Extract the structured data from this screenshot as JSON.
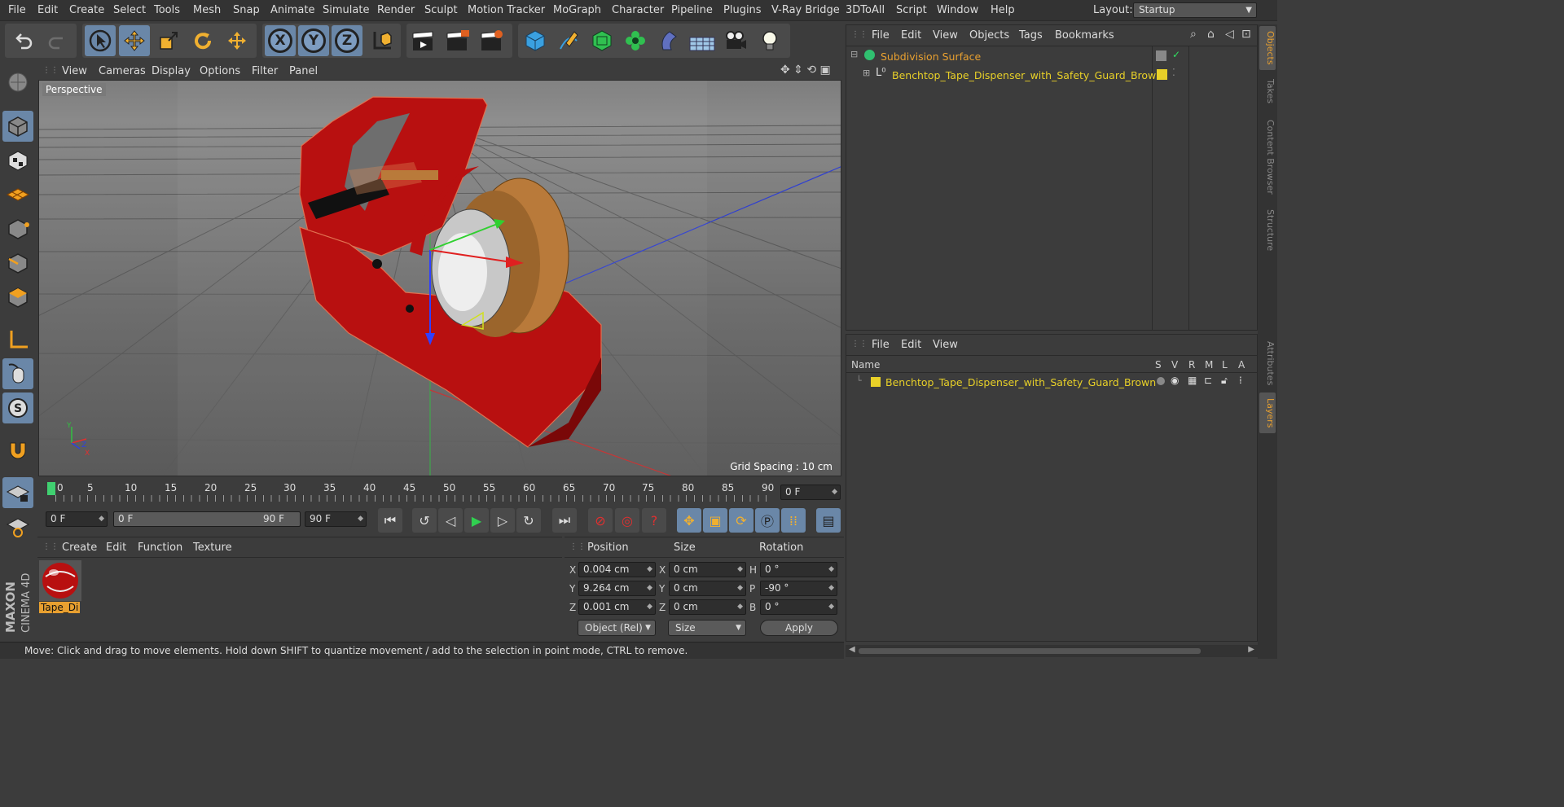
{
  "menubar": {
    "items": [
      "File",
      "Edit",
      "Create",
      "Select",
      "Tools",
      "Mesh",
      "Snap",
      "Animate",
      "Simulate",
      "Render",
      "Sculpt",
      "Motion Tracker",
      "MoGraph",
      "Character",
      "Pipeline",
      "Plugins",
      "V-Ray Bridge",
      "3DToAll",
      "Script",
      "Window",
      "Help"
    ],
    "layout_label": "Layout:",
    "layout_value": "Startup"
  },
  "toolbar": {
    "axis_x": "X",
    "axis_y": "Y",
    "axis_z": "Z"
  },
  "viewport": {
    "menu": [
      "View",
      "Cameras",
      "Display",
      "Options",
      "Filter",
      "Panel"
    ],
    "label": "Perspective",
    "grid_spacing": "Grid Spacing : 10 cm",
    "axis_y": "Y",
    "axis_z": "Z",
    "axis_x": "X"
  },
  "timeline": {
    "ticks": [
      "0",
      "5",
      "10",
      "15",
      "20",
      "25",
      "30",
      "35",
      "40",
      "45",
      "50",
      "55",
      "60",
      "65",
      "70",
      "75",
      "80",
      "85",
      "90"
    ],
    "current_frame": "0 F",
    "start_field": "0 F",
    "range_start": "0 F",
    "range_end": "90 F",
    "end_field": "90 F"
  },
  "material_panel": {
    "menu": [
      "Create",
      "Edit",
      "Function",
      "Texture"
    ],
    "material_name": "Tape_Di"
  },
  "coord_panel": {
    "headers": {
      "position": "Position",
      "size": "Size",
      "rotation": "Rotation"
    },
    "pos": {
      "x_lbl": "X",
      "x": "0.004 cm",
      "y_lbl": "Y",
      "y": "9.264 cm",
      "z_lbl": "Z",
      "z": "0.001 cm"
    },
    "size": {
      "x_lbl": "X",
      "x": "0 cm",
      "y_lbl": "Y",
      "y": "0 cm",
      "z_lbl": "Z",
      "z": "0 cm"
    },
    "rot": {
      "h_lbl": "H",
      "h": "0 °",
      "p_lbl": "P",
      "p": "-90 °",
      "b_lbl": "B",
      "b": "0 °"
    },
    "mode": "Object (Rel)",
    "size_mode": "Size",
    "apply": "Apply"
  },
  "status": {
    "text": "Move: Click and drag to move elements. Hold down SHIFT to quantize movement / add to the selection in point mode, CTRL to remove."
  },
  "object_manager": {
    "menu": [
      "File",
      "Edit",
      "View",
      "Objects",
      "Tags",
      "Bookmarks"
    ],
    "objects": [
      {
        "name": "Subdivision Surface",
        "color": "#e8a030"
      },
      {
        "name": "Benchtop_Tape_Dispenser_with_Safety_Guard_Brown",
        "color": "#e8d028"
      }
    ]
  },
  "layer_manager": {
    "menu": [
      "File",
      "Edit",
      "View"
    ],
    "columns": {
      "name": "Name",
      "s": "S",
      "v": "V",
      "r": "R",
      "m": "M",
      "l": "L",
      "a": "A"
    },
    "layers": [
      {
        "name": "Benchtop_Tape_Dispenser_with_Safety_Guard_Brown",
        "color": "#e8d028"
      }
    ]
  },
  "right_tabs": [
    "Objects",
    "Takes",
    "Content Browser",
    "Structure",
    "Attributes",
    "Layers"
  ],
  "branding": {
    "line1": "MAXON",
    "line2": "CINEMA 4D"
  },
  "colors": {
    "accent": "#e8a030",
    "selected_tool": "#6a87a8",
    "model_red": "#b81010",
    "tape_brown": "#b97a3a"
  }
}
